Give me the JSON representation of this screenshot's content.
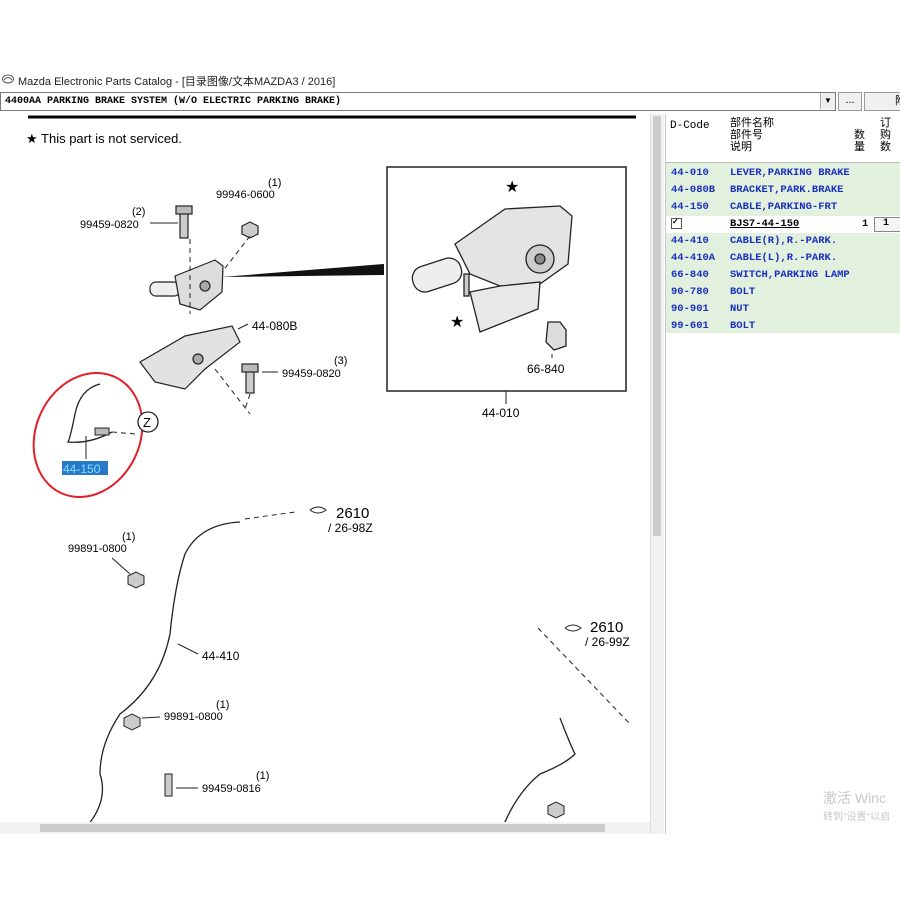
{
  "window": {
    "title": "Mazda Electronic Parts Catalog - [目录图像/文本MAZDA3 / 2016]"
  },
  "toolbar": {
    "section_select": "4400AA  PARKING BRAKE SYSTEM (W/O ELECTRIC PARKING BRAKE)",
    "browse_label": "...",
    "search_label": "附"
  },
  "diagram": {
    "note": "★ This part is not serviced.",
    "labels": {
      "p99946_qty": "(1)",
      "p99946": "99946-0600",
      "p99459a_qty": "(2)",
      "p99459a": "99459-0820",
      "p44080b": "44-080B",
      "p99459b_qty": "(3)",
      "p99459b": "99459-0820",
      "z": "Z",
      "p44150": "44-150",
      "p66840": "66-840",
      "p44010": "44-010",
      "ref2610a": "2610",
      "ref2698z": "/ 26-98Z",
      "p99891a_qty": "(1)",
      "p99891a": "99891-0800",
      "p44410": "44-410",
      "ref2610b": "2610",
      "ref2699z": "/ 26-99Z",
      "p99891b_qty": "(1)",
      "p99891b": "99891-0800",
      "p99459c_qty": "(1)",
      "p99459c": "99459-0816"
    }
  },
  "parts_panel": {
    "headers": {
      "dcode": "D-Code",
      "name_line1": "部件名称",
      "name_line2": "部件号",
      "name_line3": "说明",
      "qty_line1": "数",
      "qty_line2": "量",
      "order_line1": "订",
      "order_line2": "购",
      "order_line3": "数"
    },
    "rows": [
      {
        "code": "44-010",
        "name": "LEVER,PARKING BRAKE",
        "qty": "",
        "order": ""
      },
      {
        "code": "44-080B",
        "name": "BRACKET,PARK.BRAKE",
        "qty": "",
        "order": ""
      },
      {
        "code": "44-150",
        "name": "CABLE,PARKING-FRT",
        "qty": "",
        "order": ""
      },
      {
        "code": "✓",
        "name": "BJS7-44-150",
        "qty": "1",
        "order": "1"
      },
      {
        "code": "44-410",
        "name": "CABLE(R),R.-PARK.",
        "qty": "",
        "order": ""
      },
      {
        "code": "44-410A",
        "name": "CABLE(L),R.-PARK.",
        "qty": "",
        "order": ""
      },
      {
        "code": "66-840",
        "name": "SWITCH,PARKING LAMP",
        "qty": "",
        "order": ""
      },
      {
        "code": "90-780",
        "name": "BOLT",
        "qty": "",
        "order": ""
      },
      {
        "code": "90-901",
        "name": "NUT",
        "qty": "",
        "order": ""
      },
      {
        "code": "99-601",
        "name": "BOLT",
        "qty": "",
        "order": ""
      }
    ]
  },
  "watermark": {
    "line1": "激活 Winc",
    "line2": "转到\"设置\"以启"
  },
  "colors": {
    "code_blue": "#1a2fbf",
    "row_green": "#e2f1de",
    "highlight_circle": "#e0202a",
    "selected_label_bg": "#2a78c8"
  }
}
